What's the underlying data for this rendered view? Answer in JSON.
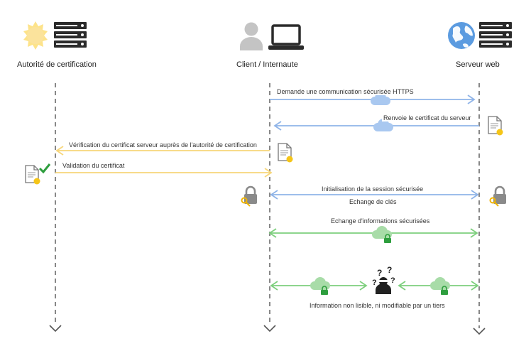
{
  "actors": {
    "ca": {
      "label": "Autorité de certification",
      "icons": [
        "sun-seal-icon",
        "server-rack-icon"
      ]
    },
    "client": {
      "label": "Client / Internaute",
      "icons": [
        "user-icon",
        "laptop-icon"
      ]
    },
    "server": {
      "label": "Serveur web",
      "icons": [
        "globe-icon",
        "server-rack-icon"
      ]
    }
  },
  "messages": {
    "https_request": "Demande une communication sécurisée HTTPS",
    "send_cert": "Renvoie le certificat du serveur",
    "verify_cert": "Vérification du certificat serveur auprès de l'autorité de certification",
    "validate_cert": "Validation du certificat",
    "session_init": "Initialisation de la session sécurisée",
    "key_exchange": "Echange de clés",
    "secure_info": "Echange d'informations sécurisées",
    "third_party": "Information non lisible, ni modifiable par un tiers"
  },
  "colors": {
    "blue": "#8fb4e8",
    "yellow": "#f7d67a",
    "green": "#7dcf7d",
    "cloud_blue": "#a9c8f0",
    "cloud_green": "#a8dca8",
    "lifeline": "#555555",
    "seal": "#f5c518",
    "lock_green": "#2e9e3e"
  }
}
